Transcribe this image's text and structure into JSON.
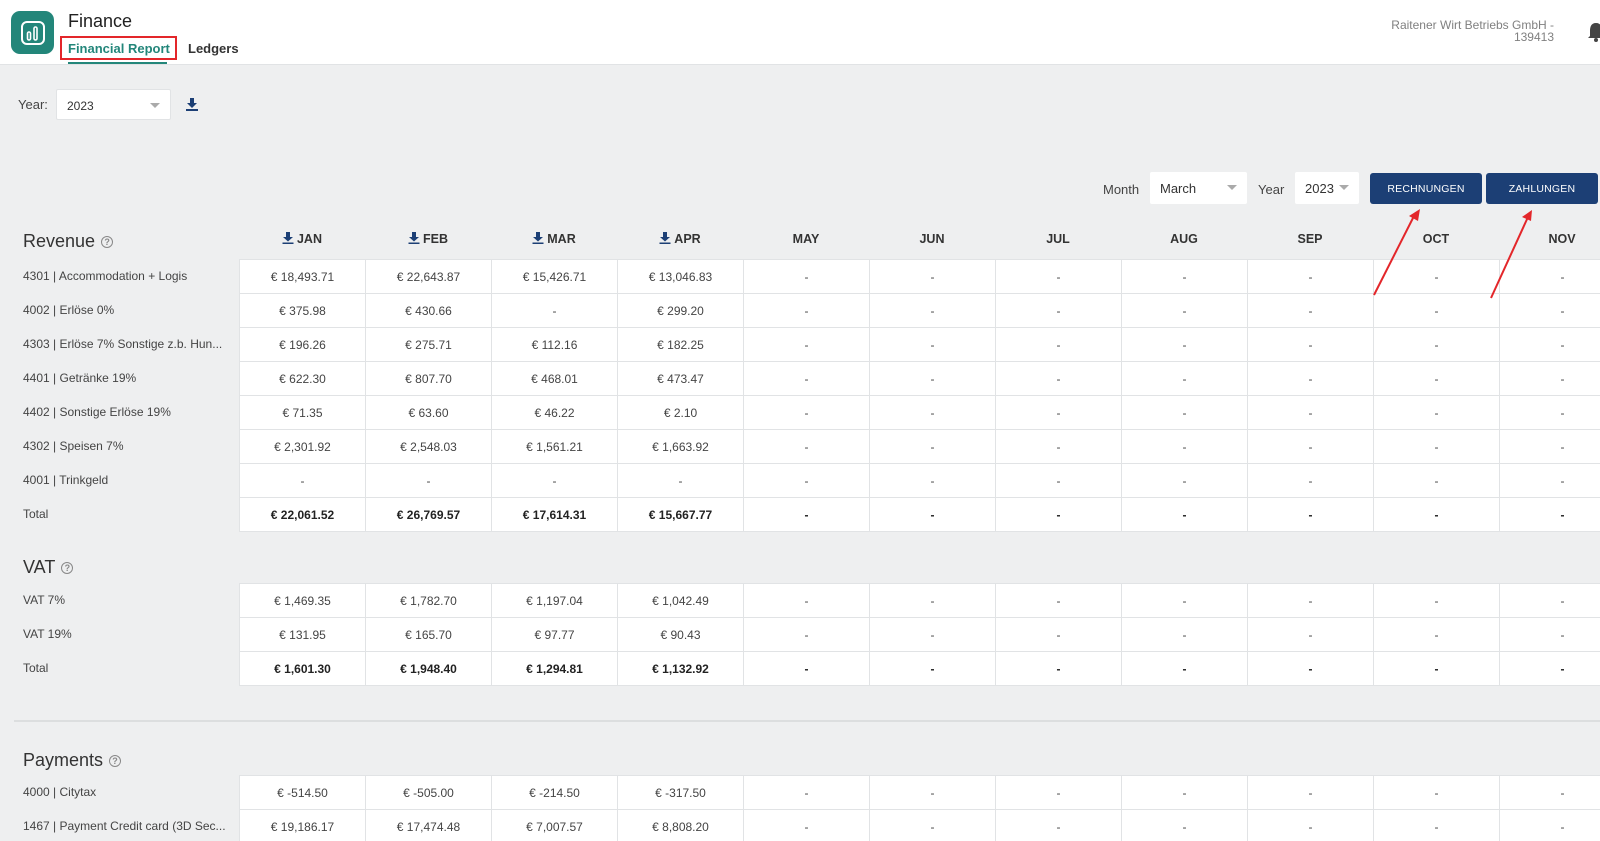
{
  "header": {
    "app_title": "Finance",
    "tabs": [
      {
        "label": "Financial Report",
        "active": true
      },
      {
        "label": "Ledgers",
        "active": false
      }
    ],
    "company_line1": "Raitener Wirt Betriebs GmbH -",
    "company_line2": "139413"
  },
  "filters": {
    "year_label": "Year:",
    "year_value": "2023",
    "month_label": "Month",
    "month_value": "March",
    "year2_label": "Year",
    "year2_value": "2023",
    "rechnungen_label": "RECHNUNGEN",
    "zahlungen_label": "ZAHLUNGEN"
  },
  "months": [
    "JAN",
    "FEB",
    "MAR",
    "APR",
    "MAY",
    "JUN",
    "JUL",
    "AUG",
    "SEP",
    "OCT",
    "NOV"
  ],
  "sections": {
    "revenue": {
      "title": "Revenue",
      "rows": [
        {
          "label": "4301 | Accommodation + Logis",
          "values": [
            "€ 18,493.71",
            "€ 22,643.87",
            "€ 15,426.71",
            "€ 13,046.83",
            "-",
            "-",
            "-",
            "-",
            "-",
            "-",
            "-"
          ]
        },
        {
          "label": "4002 | Erlöse 0%",
          "values": [
            "€ 375.98",
            "€ 430.66",
            "-",
            "€ 299.20",
            "-",
            "-",
            "-",
            "-",
            "-",
            "-",
            "-"
          ]
        },
        {
          "label": "4303 | Erlöse 7% Sonstige z.b. Hun...",
          "values": [
            "€ 196.26",
            "€ 275.71",
            "€ 112.16",
            "€ 182.25",
            "-",
            "-",
            "-",
            "-",
            "-",
            "-",
            "-"
          ]
        },
        {
          "label": "4401 | Getränke 19%",
          "values": [
            "€ 622.30",
            "€ 807.70",
            "€ 468.01",
            "€ 473.47",
            "-",
            "-",
            "-",
            "-",
            "-",
            "-",
            "-"
          ]
        },
        {
          "label": "4402 | Sonstige Erlöse 19%",
          "values": [
            "€ 71.35",
            "€ 63.60",
            "€ 46.22",
            "€ 2.10",
            "-",
            "-",
            "-",
            "-",
            "-",
            "-",
            "-"
          ]
        },
        {
          "label": "4302 | Speisen 7%",
          "values": [
            "€ 2,301.92",
            "€ 2,548.03",
            "€ 1,561.21",
            "€ 1,663.92",
            "-",
            "-",
            "-",
            "-",
            "-",
            "-",
            "-"
          ]
        },
        {
          "label": "4001 | Trinkgeld",
          "values": [
            "-",
            "-",
            "-",
            "-",
            "-",
            "-",
            "-",
            "-",
            "-",
            "-",
            "-"
          ]
        },
        {
          "label": "Total",
          "total": true,
          "values": [
            "€ 22,061.52",
            "€ 26,769.57",
            "€ 17,614.31",
            "€ 15,667.77",
            "-",
            "-",
            "-",
            "-",
            "-",
            "-",
            "-"
          ]
        }
      ]
    },
    "vat": {
      "title": "VAT",
      "rows": [
        {
          "label": "VAT 7%",
          "values": [
            "€ 1,469.35",
            "€ 1,782.70",
            "€ 1,197.04",
            "€ 1,042.49",
            "-",
            "-",
            "-",
            "-",
            "-",
            "-",
            "-"
          ]
        },
        {
          "label": "VAT 19%",
          "values": [
            "€ 131.95",
            "€ 165.70",
            "€ 97.77",
            "€ 90.43",
            "-",
            "-",
            "-",
            "-",
            "-",
            "-",
            "-"
          ]
        },
        {
          "label": "Total",
          "total": true,
          "values": [
            "€ 1,601.30",
            "€ 1,948.40",
            "€ 1,294.81",
            "€ 1,132.92",
            "-",
            "-",
            "-",
            "-",
            "-",
            "-",
            "-"
          ]
        }
      ]
    },
    "payments": {
      "title": "Payments",
      "rows": [
        {
          "label": "4000 | Citytax",
          "values": [
            "€ -514.50",
            "€ -505.00",
            "€ -214.50",
            "€ -317.50",
            "-",
            "-",
            "-",
            "-",
            "-",
            "-",
            "-"
          ]
        },
        {
          "label": "1467 | Payment Credit card (3D Sec...",
          "values": [
            "€ 19,186.17",
            "€ 17,474.48",
            "€ 7,007.57",
            "€ 8,808.20",
            "-",
            "-",
            "-",
            "-",
            "-",
            "-",
            "-"
          ]
        }
      ]
    }
  },
  "icons": {
    "app": "bar-chart-icon",
    "download": "download-icon",
    "help": "question-circle-icon",
    "notification": "bell-icon"
  },
  "colors": {
    "accent": "#23867a",
    "button": "#1c3f75",
    "highlight": "#e3262a"
  }
}
